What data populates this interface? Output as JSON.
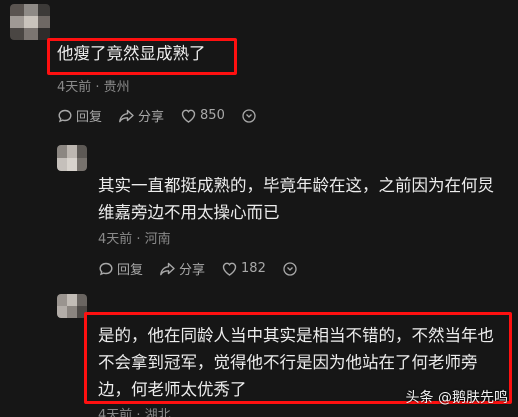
{
  "comments": [
    {
      "text": "他瘦了竟然显成熟了",
      "meta": "4天前 · 贵州",
      "likes": "850"
    },
    {
      "text_line1": "其实一直都挺成熟的，毕竟年龄在这，之前因为在何炅",
      "text_line2": "维嘉旁边不用太操心而已",
      "meta": "4天前 · 河南",
      "likes": "182"
    },
    {
      "text_line1": "是的，他在同龄人当中其实是相当不错的，不然当年也",
      "text_line2": "不会拿到冠军，觉得他不行是因为他站在了何老师旁",
      "text_line3": "边，何老师太优秀了",
      "meta": "4天前 · 湖北"
    }
  ],
  "actions": {
    "reply": "回复",
    "share": "分享"
  },
  "watermark": {
    "prefix": "头条",
    "handle": "@鹅肤先鸣"
  },
  "colors": {
    "highlight": "#ff1010",
    "background": "#161616"
  }
}
